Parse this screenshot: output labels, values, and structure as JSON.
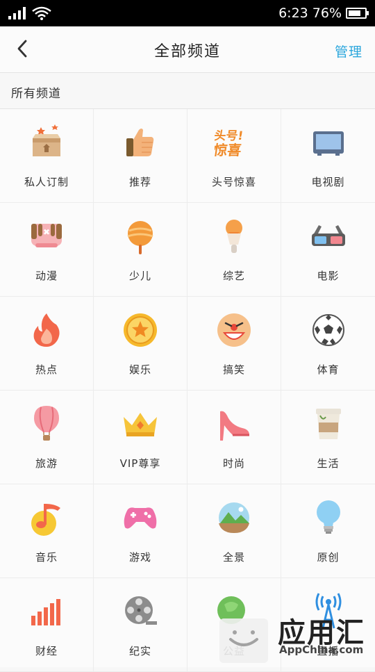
{
  "status": {
    "time": "6:23",
    "battery": "76%",
    "battery_level": 0.76
  },
  "header": {
    "title": "全部频道",
    "manage": "管理"
  },
  "section": {
    "title": "所有频道"
  },
  "channels": [
    {
      "label": "私人订制",
      "icon": "gift-box-icon"
    },
    {
      "label": "推荐",
      "icon": "thumbs-up-icon"
    },
    {
      "label": "头号惊喜",
      "icon": "surprise-logo-icon"
    },
    {
      "label": "电视剧",
      "icon": "tv-icon"
    },
    {
      "label": "动漫",
      "icon": "anime-mask-icon"
    },
    {
      "label": "少儿",
      "icon": "lollipop-icon"
    },
    {
      "label": "综艺",
      "icon": "microphone-icon"
    },
    {
      "label": "电影",
      "icon": "3d-glasses-icon"
    },
    {
      "label": "热点",
      "icon": "flame-icon"
    },
    {
      "label": "娱乐",
      "icon": "star-coin-icon"
    },
    {
      "label": "搞笑",
      "icon": "clown-face-icon"
    },
    {
      "label": "体育",
      "icon": "soccer-ball-icon"
    },
    {
      "label": "旅游",
      "icon": "hot-air-balloon-icon"
    },
    {
      "label": "VIP尊享",
      "icon": "crown-icon"
    },
    {
      "label": "时尚",
      "icon": "high-heel-icon"
    },
    {
      "label": "生活",
      "icon": "cup-icon"
    },
    {
      "label": "音乐",
      "icon": "music-note-icon"
    },
    {
      "label": "游戏",
      "icon": "gamepad-icon"
    },
    {
      "label": "全景",
      "icon": "panorama-icon"
    },
    {
      "label": "原创",
      "icon": "lightbulb-icon"
    },
    {
      "label": "财经",
      "icon": "bar-chart-icon"
    },
    {
      "label": "纪实",
      "icon": "film-reel-icon"
    },
    {
      "label": "公益",
      "icon": "green-globe-icon"
    },
    {
      "label": "直播",
      "icon": "broadcast-icon"
    }
  ],
  "watermark": {
    "text": "应用汇",
    "sub": "AppChina.com"
  }
}
